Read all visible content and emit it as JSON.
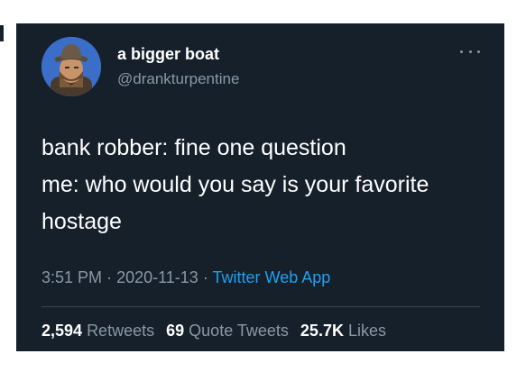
{
  "colors": {
    "card_background": "#15202b",
    "primary_text": "#ffffff",
    "secondary_text": "#8899a6",
    "link": "#1da1f2",
    "divider": "#38444d",
    "avatar_ring": "#3a6ec9"
  },
  "author": {
    "display_name": "a bigger boat",
    "handle": "@drankturpentine",
    "avatar_icon": "profile-avatar-icon"
  },
  "tweet": {
    "lines": [
      "bank robber: fine one question",
      "me: who would you say is your favorite",
      "hostage"
    ],
    "time": "3:51 PM",
    "separator": "·",
    "date": "2020-11-13",
    "source": "Twitter Web App"
  },
  "menu": {
    "icon": "more-options-icon"
  },
  "stats": {
    "retweets_count": "2,594",
    "retweets_label": "Retweets",
    "quotes_count": "69",
    "quotes_label": "Quote Tweets",
    "likes_count": "25.7K",
    "likes_label": "Likes"
  }
}
